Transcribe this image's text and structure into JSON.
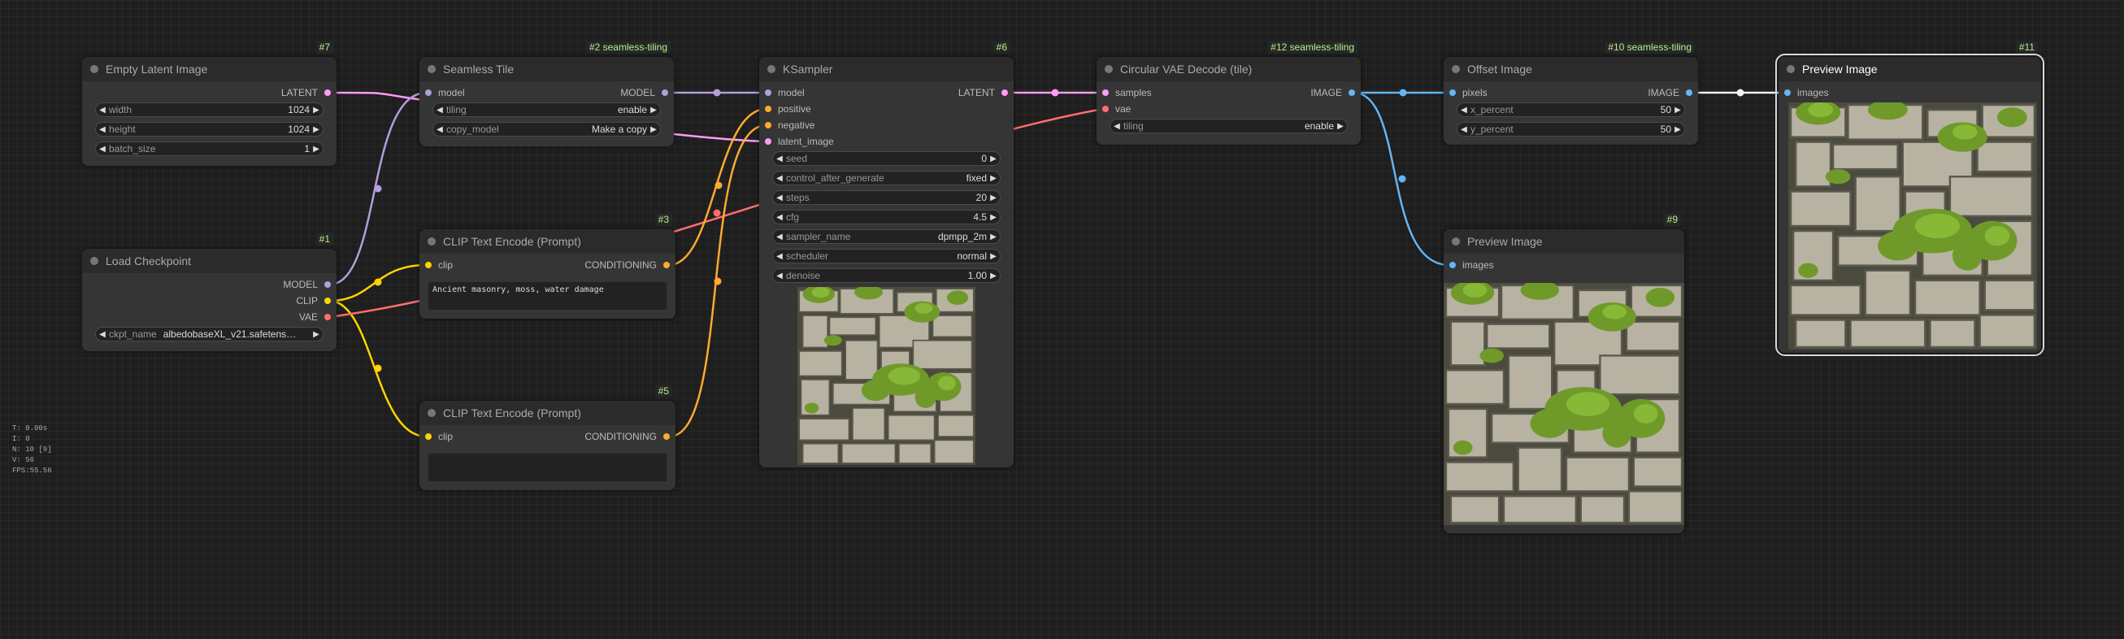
{
  "nodes": {
    "n7": {
      "id": "#7",
      "title": "Empty Latent Image",
      "outputs": [
        {
          "label": "LATENT",
          "color": "#ff9cf9"
        }
      ],
      "widgets": [
        {
          "name": "width",
          "value": "1024"
        },
        {
          "name": "height",
          "value": "1024"
        },
        {
          "name": "batch_size",
          "value": "1"
        }
      ]
    },
    "n1": {
      "id": "#1",
      "title": "Load Checkpoint",
      "outputs": [
        {
          "label": "MODEL",
          "color": "#b39ddb"
        },
        {
          "label": "CLIP",
          "color": "#ffd500"
        },
        {
          "label": "VAE",
          "color": "#ff6e6e"
        }
      ],
      "widgets": [
        {
          "name": "ckpt_name",
          "value": "albedobaseXL_v21.safetens…"
        }
      ]
    },
    "n2": {
      "id": "#2 seamless-tiling",
      "title": "Seamless Tile",
      "inputs": [
        {
          "label": "model",
          "color": "#b39ddb"
        }
      ],
      "outputs": [
        {
          "label": "MODEL",
          "color": "#b39ddb"
        }
      ],
      "widgets": [
        {
          "name": "tiling",
          "value": "enable"
        },
        {
          "name": "copy_model",
          "value": "Make a copy"
        }
      ]
    },
    "n3": {
      "id": "#3",
      "title": "CLIP Text Encode (Prompt)",
      "inputs": [
        {
          "label": "clip",
          "color": "#ffd500"
        }
      ],
      "outputs": [
        {
          "label": "CONDITIONING",
          "color": "#ffa931"
        }
      ],
      "text": "Ancient masonry, moss, water damage"
    },
    "n5": {
      "id": "#5",
      "title": "CLIP Text Encode (Prompt)",
      "inputs": [
        {
          "label": "clip",
          "color": "#ffd500"
        }
      ],
      "outputs": [
        {
          "label": "CONDITIONING",
          "color": "#ffa931"
        }
      ],
      "text": ""
    },
    "n6": {
      "id": "#6",
      "title": "KSampler",
      "inputs": [
        {
          "label": "model",
          "color": "#b39ddb"
        },
        {
          "label": "positive",
          "color": "#ffa931"
        },
        {
          "label": "negative",
          "color": "#ffa931"
        },
        {
          "label": "latent_image",
          "color": "#ff9cf9"
        }
      ],
      "outputs": [
        {
          "label": "LATENT",
          "color": "#ff9cf9"
        }
      ],
      "widgets": [
        {
          "name": "seed",
          "value": "0"
        },
        {
          "name": "control_after_generate",
          "value": "fixed"
        },
        {
          "name": "steps",
          "value": "20"
        },
        {
          "name": "cfg",
          "value": "4.5"
        },
        {
          "name": "sampler_name",
          "value": "dpmpp_2m"
        },
        {
          "name": "scheduler",
          "value": "normal"
        },
        {
          "name": "denoise",
          "value": "1.00"
        }
      ]
    },
    "n12": {
      "id": "#12 seamless-tiling",
      "title": "Circular VAE Decode (tile)",
      "inputs": [
        {
          "label": "samples",
          "color": "#ff9cf9"
        },
        {
          "label": "vae",
          "color": "#ff6e6e"
        }
      ],
      "outputs": [
        {
          "label": "IMAGE",
          "color": "#64b5f6"
        }
      ],
      "widgets": [
        {
          "name": "tiling",
          "value": "enable"
        }
      ]
    },
    "n10": {
      "id": "#10 seamless-tiling",
      "title": "Offset Image",
      "inputs": [
        {
          "label": "pixels",
          "color": "#64b5f6"
        }
      ],
      "outputs": [
        {
          "label": "IMAGE",
          "color": "#64b5f6"
        }
      ],
      "widgets": [
        {
          "name": "x_percent",
          "value": "50"
        },
        {
          "name": "y_percent",
          "value": "50"
        }
      ]
    },
    "n9": {
      "id": "#9",
      "title": "Preview Image",
      "inputs": [
        {
          "label": "images",
          "color": "#64b5f6"
        }
      ]
    },
    "n11": {
      "id": "#11",
      "title": "Preview Image",
      "inputs": [
        {
          "label": "images",
          "color": "#64b5f6"
        }
      ]
    }
  },
  "stats": {
    "t": "T: 0.00s",
    "i": "I: 0",
    "n": "N: 10 [9]",
    "v": "V: 56",
    "fps": "FPS:55.56"
  },
  "colors": {
    "canvas": "#1e1e1e",
    "node_body": "#353535",
    "node_title": "#2b2b2b",
    "badge_text": "#b5f08a",
    "model": "#b39ddb",
    "clip": "#ffd500",
    "vae": "#ff6e6e",
    "latent": "#ff9cf9",
    "conditioning": "#ffa931",
    "image": "#64b5f6"
  }
}
